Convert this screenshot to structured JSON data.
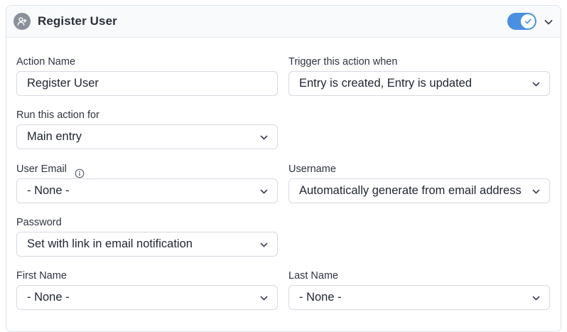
{
  "header": {
    "title": "Register User",
    "icon": "add-user-icon",
    "toggle_on": true
  },
  "fields": {
    "action_name": {
      "label": "Action Name",
      "value": "Register User"
    },
    "trigger": {
      "label": "Trigger this action when",
      "value": "Entry is created, Entry is updated"
    },
    "run_for": {
      "label": "Run this action for",
      "value": "Main entry"
    },
    "user_email": {
      "label": "User Email",
      "value": "- None -",
      "icon": "info-icon"
    },
    "username": {
      "label": "Username",
      "value": "Automatically generate from email address"
    },
    "password": {
      "label": "Password",
      "value": "Set with link in email notification"
    },
    "first_name": {
      "label": "First Name",
      "value": "- None -"
    },
    "last_name": {
      "label": "Last Name",
      "value": "- None -"
    }
  },
  "colors": {
    "accent": "#4a90e2",
    "border": "#d5dae2",
    "header_bg": "#f9fafb"
  }
}
